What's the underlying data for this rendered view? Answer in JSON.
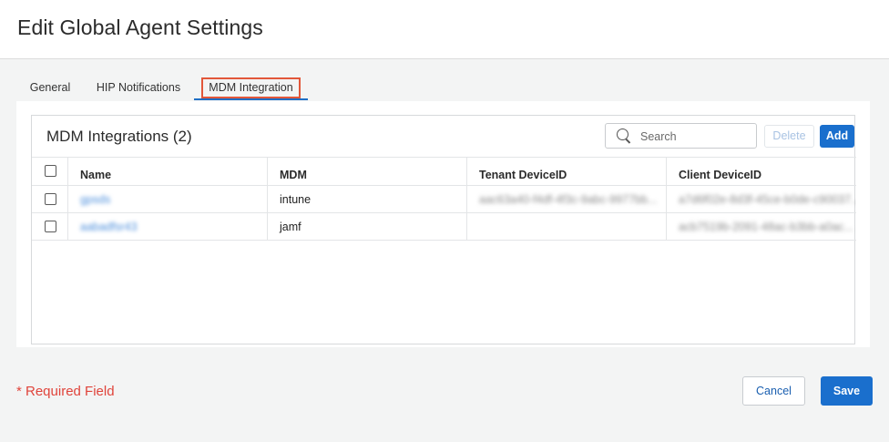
{
  "dialog": {
    "title": "Edit Global Agent Settings"
  },
  "tabs": [
    {
      "label": "General"
    },
    {
      "label": "HIP Notifications"
    },
    {
      "label": "MDM Integration"
    }
  ],
  "card": {
    "title": "MDM Integrations (2)",
    "search": {
      "placeholder": "Search",
      "value": ""
    },
    "delete_label": "Delete",
    "add_label": "Add"
  },
  "table": {
    "columns": [
      "Name",
      "MDM",
      "Tenant DeviceID",
      "Client DeviceID"
    ],
    "rows": [
      {
        "name": "gpsds",
        "mdm": "intune",
        "tenant": "aac63a40-f4df-4f3c-9abc-9977bb...",
        "client": "a7d6f02e-8d3f-45ce-b0de-c90037..."
      },
      {
        "name": "aabadfsr43",
        "mdm": "jamf",
        "tenant": "",
        "client": "acb7519b-2091-48ac-b3bb-a0ac..."
      }
    ]
  },
  "footer": {
    "required_label": "* Required Field",
    "cancel_label": "Cancel",
    "save_label": "Save"
  },
  "colors": {
    "accent": "#1a6fcd",
    "required": "#e0443b",
    "highlight": "#e2573a"
  }
}
